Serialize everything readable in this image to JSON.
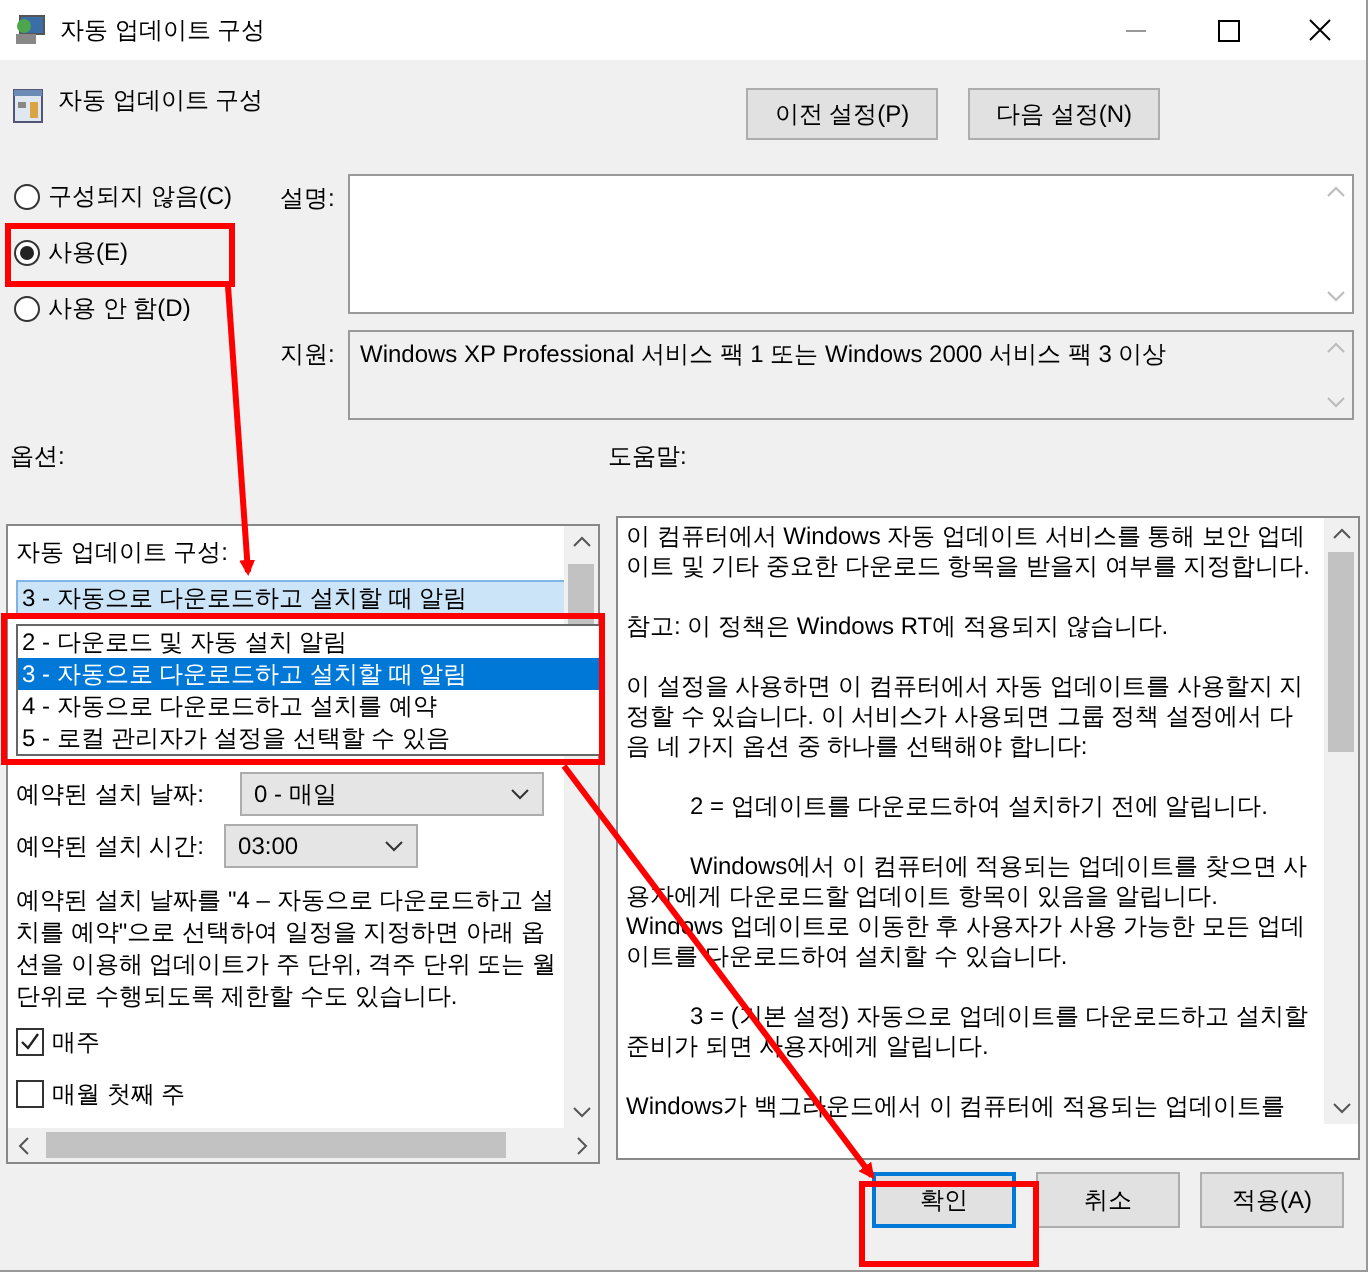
{
  "window": {
    "title": "자동 업데이트 구성"
  },
  "header": {
    "title": "자동 업데이트 구성",
    "buttons": [
      "이전 설정(P)",
      "다음 설정(N)"
    ]
  },
  "state_options": [
    {
      "label": "구성되지 않음(C)",
      "selected": false
    },
    {
      "label": "사용(E)",
      "selected": true
    },
    {
      "label": "사용 안 함(D)",
      "selected": false
    }
  ],
  "comment": {
    "label": "설명:"
  },
  "supported": {
    "label": "지원:",
    "value": "Windows XP Professional 서비스 팩 1 또는 Windows 2000 서비스 팩 3 이상"
  },
  "options": {
    "heading": "옵션:",
    "configure_label": "자동 업데이트 구성:",
    "configure_value": "3 - 자동으로 다운로드하고 설치할 때 알림",
    "dropdown_items": [
      {
        "label": "2 - 다운로드 및 자동 설치 알림",
        "selected": false
      },
      {
        "label": "3 - 자동으로 다운로드하고 설치할 때 알림",
        "selected": true
      },
      {
        "label": "4 - 자동으로 다운로드하고 설치를 예약",
        "selected": false
      },
      {
        "label": "5 - 로컬 관리자가 설정을 선택할 수 있음",
        "selected": false
      }
    ],
    "install_day": {
      "label": "예약된 설치 날짜:",
      "value": "0 - 매일"
    },
    "install_time": {
      "label": "예약된 설치 시간:",
      "value": "03:00"
    },
    "note": "예약된 설치 날짜를 \"4 – 자동으로 다운로드하고 설치를 예약\"으로 선택하여 일정을 지정하면 아래 옵션을 이용해 업데이트가 주 단위, 격주 단위 또는 월 단위로 수행되도록 제한할 수도 있습니다.",
    "checkboxes": [
      {
        "label": "매주",
        "checked": true
      },
      {
        "label": "매월 첫째 주",
        "checked": false
      }
    ]
  },
  "help": {
    "heading": "도움말:",
    "paragraphs": [
      {
        "kind": "plain",
        "text": "이 컴퓨터에서 Windows 자동 업데이트 서비스를 통해 보안 업데이트 및 기타 중요한 다운로드 항목을 받을지 여부를 지정합니다."
      },
      {
        "kind": "plain",
        "text": "참고: 이 정책은 Windows RT에 적용되지 않습니다."
      },
      {
        "kind": "plain",
        "text": "이 설정을 사용하면 이 컴퓨터에서 자동 업데이트를 사용할지 지정할 수 있습니다. 이 서비스가 사용되면 그룹 정책 설정에서 다음 네 가지 옵션 중 하나를 선택해야 합니다:"
      },
      {
        "kind": "indented",
        "text": "2 = 업데이트를 다운로드하여 설치하기 전에 알립니다."
      },
      {
        "kind": "indented",
        "text": "Windows에서 이 컴퓨터에 적용되는 업데이트를 찾으면 사용자에게 다운로드할 업데이트 항목이 있음을 알립니다. Windows 업데이트로 이동한 후 사용자가 사용 가능한 모든 업데이트를 다운로드하여 설치할 수 있습니다."
      },
      {
        "kind": "indented",
        "text": "3 = (기본 설정) 자동으로 업데이트를 다운로드하고 설치할 준비가 되면 사용자에게 알립니다."
      },
      {
        "kind": "plain",
        "text": "Windows가 백그라운드에서 이 컴퓨터에 적용되는 업데이트를"
      }
    ]
  },
  "buttons": [
    {
      "label": "확인",
      "focused": true
    },
    {
      "label": "취소",
      "focused": false
    },
    {
      "label": "적용(A)",
      "focused": false
    }
  ]
}
